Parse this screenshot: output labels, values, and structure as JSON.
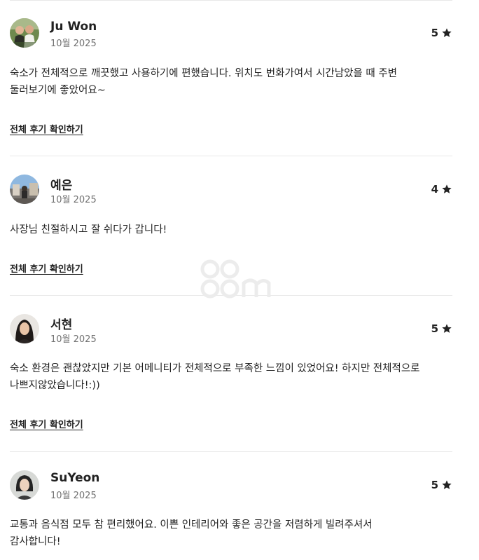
{
  "reviews": [
    {
      "name": "Ju Won",
      "date": "10월 2025",
      "rating": "5",
      "body_lines": [
        "숙소가 전체적으로 깨끗했고 사용하기에 편했습니다. 위치도 번화가여서 시간남았을 때 주변",
        "둘러보기에 좋았어요~"
      ],
      "more_label": "전체 후기 확인하기"
    },
    {
      "name": "예은",
      "date": "10월 2025",
      "rating": "4",
      "body_lines": [
        "사장님 친절하시고 잘 쉬다가 갑니다!"
      ],
      "more_label": "전체 후기 확인하기"
    },
    {
      "name": "서현",
      "date": "10월 2025",
      "rating": "5",
      "body_lines": [
        "숙소 환경은 괜찮았지만 기본 어메니티가 전체적으로 부족한 느낌이 있었어요! 하지만 전체적으로",
        "나쁘지않았습니다!:))"
      ],
      "more_label": "전체 후기 확인하기"
    },
    {
      "name": "SuYeon",
      "date": "10월 2025",
      "rating": "5",
      "body_lines": [
        "교통과 음식점 모두 참 편리했어요. 이쁜 인테리어와 좋은 공간을 저렴하게 빌려주셔서",
        "감사합니다!"
      ]
    }
  ],
  "icons": {
    "rating": "star-icon"
  },
  "colors": {
    "text": "#222222",
    "muted": "#717171",
    "divider": "#e8e8e8"
  }
}
